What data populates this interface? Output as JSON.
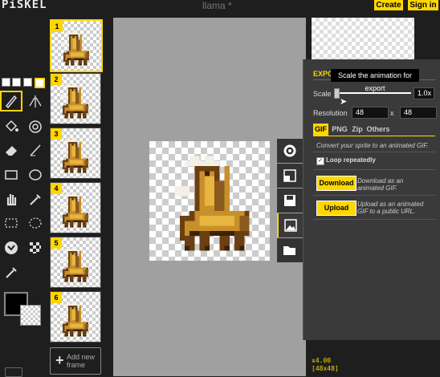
{
  "header": {
    "logo": "PiSKEL",
    "title": "llama *",
    "create_label": "Create",
    "signin_label": "Sign in",
    "accent": "#ffd700"
  },
  "tools": {
    "icons": [
      "pen-icon",
      "mirror-pen-icon",
      "paint-bucket-icon",
      "spray-icon",
      "eraser-icon",
      "stroke-icon",
      "rectangle-icon",
      "circle-icon",
      "hand-icon",
      "eyedropper-icon",
      "rect-select-icon",
      "lasso-select-icon",
      "shape-select-icon",
      "dither-icon",
      "color-picker-icon"
    ],
    "primary_color": "#000000",
    "secondary_color": "transparent"
  },
  "frames": [
    {
      "num": "1",
      "selected": true
    },
    {
      "num": "2"
    },
    {
      "num": "3"
    },
    {
      "num": "4"
    },
    {
      "num": "5"
    },
    {
      "num": "6"
    }
  ],
  "add_frame": {
    "line1": "Add new",
    "line2": "frame"
  },
  "export": {
    "heading": "EXPO",
    "tooltip": "Scale the animation for export",
    "scale_label": "Scale",
    "scale_value": "1.0x",
    "resolution_label": "Resolution",
    "width": "48",
    "x_sep": "x",
    "height": "48",
    "tabs": [
      "GIF",
      "PNG",
      "Zip",
      "Others"
    ],
    "gif_desc": "Convert your sprite to an animated GIF.",
    "loop_label": "Loop repeatedly",
    "download_label": "Download",
    "download_note": "Download as an animated GIF.",
    "upload_label": "Upload",
    "upload_note": "Upload as an animated GIF to a public URL."
  },
  "status": {
    "zoom": "x4.00",
    "size": "[48x48]"
  }
}
